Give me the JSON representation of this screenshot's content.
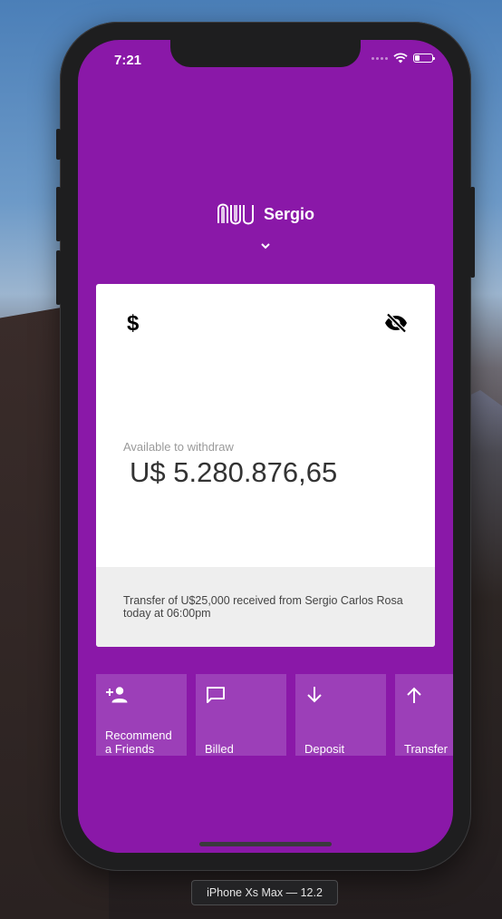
{
  "status_bar": {
    "time": "7:21"
  },
  "header": {
    "user_name": "Sergio"
  },
  "card": {
    "available_label": "Available to withdraw",
    "balance": "U$ 5.280.876,65",
    "notification": "Transfer of U$25,000 received from Sergio Carlos Rosa today at 06:00pm"
  },
  "actions": [
    {
      "label": "Recommend\na Friends",
      "icon": "person-add-icon"
    },
    {
      "label": "Billed",
      "icon": "chat-icon"
    },
    {
      "label": "Deposit",
      "icon": "arrow-down-icon"
    },
    {
      "label": "Transfer",
      "icon": "arrow-up-icon"
    }
  ],
  "device_label": "iPhone Xs Max — 12.2",
  "colors": {
    "brand_purple": "#8a18a8",
    "action_tile": "#9c3fb8",
    "card_bg": "#ffffff",
    "card_footer_bg": "#eeeeee"
  }
}
